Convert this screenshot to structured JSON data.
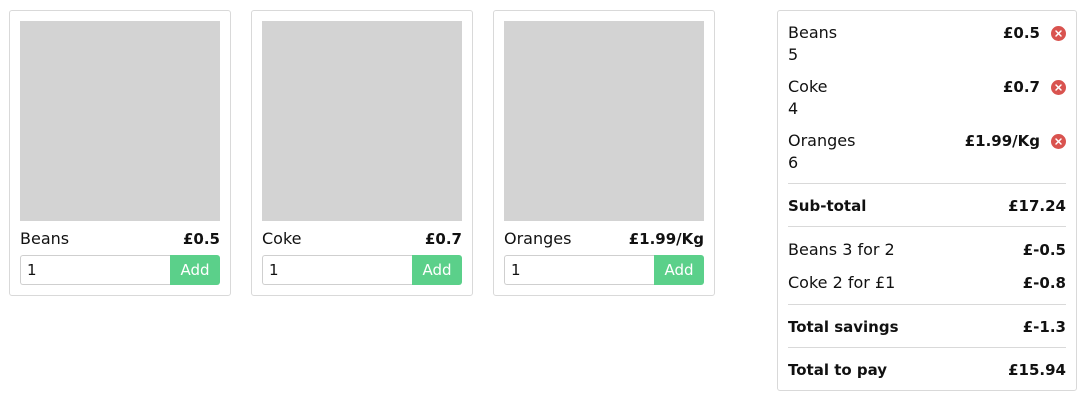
{
  "products": [
    {
      "name": "Beans",
      "price": "£0.5",
      "quantity": "1",
      "add_label": "Add"
    },
    {
      "name": "Coke",
      "price": "£0.7",
      "quantity": "1",
      "add_label": "Add"
    },
    {
      "name": "Oranges",
      "price": "£1.99/Kg",
      "quantity": "1",
      "add_label": "Add"
    }
  ],
  "basket": {
    "items": [
      {
        "name": "Beans",
        "quantity": "5",
        "price": "£0.5"
      },
      {
        "name": "Coke",
        "quantity": "4",
        "price": "£0.7"
      },
      {
        "name": "Oranges",
        "quantity": "6",
        "price": "£1.99/Kg"
      }
    ],
    "subtotal": {
      "label": "Sub-total",
      "value": "£17.24"
    },
    "savings": [
      {
        "label": "Beans 3 for 2",
        "value": "£-0.5"
      },
      {
        "label": "Coke 2 for £1",
        "value": "£-0.8"
      }
    ],
    "total_savings": {
      "label": "Total savings",
      "value": "£-1.3"
    },
    "total": {
      "label": "Total to pay",
      "value": "£15.94"
    }
  },
  "colors": {
    "add_button": "#5bd08a",
    "remove_icon": "#d9534f",
    "image_placeholder": "#d3d3d3",
    "border": "#d9d9d9"
  },
  "icons": {
    "remove": "close-circle-icon"
  }
}
